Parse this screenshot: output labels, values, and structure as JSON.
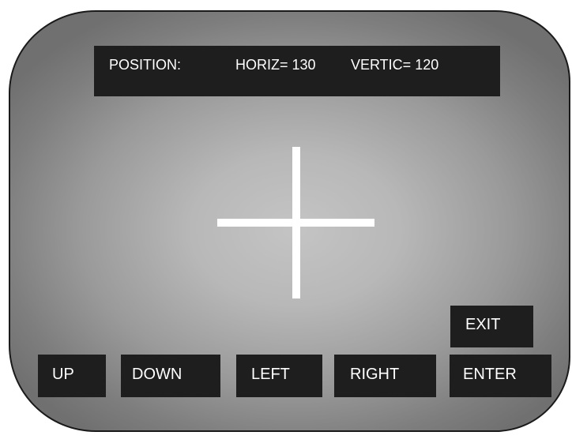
{
  "status": {
    "position_label": "POSITION:",
    "horiz_label": "HORIZ=",
    "horiz_value": "130",
    "vertic_label": "VERTIC=",
    "vertic_value": "120"
  },
  "colors": {
    "panel": "#1e1e1e",
    "text": "#ffffff",
    "crosshair": "#ffffff",
    "screen_center": "#c4c4c4",
    "screen_edge": "#707070"
  },
  "buttons": {
    "up": "UP",
    "down": "DOWN",
    "left": "LEFT",
    "right": "RIGHT",
    "enter": "ENTER",
    "exit": "EXIT"
  },
  "icons": {
    "crosshair": "crosshair-icon"
  }
}
